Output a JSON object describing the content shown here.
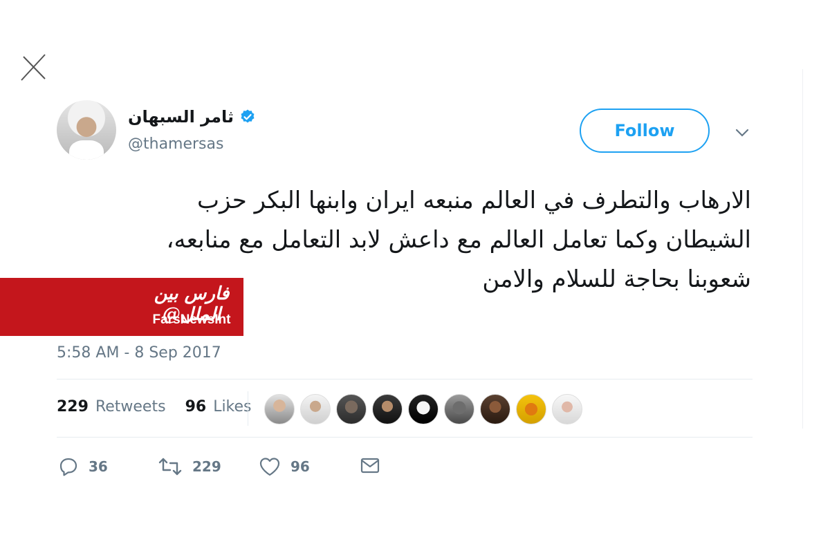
{
  "user": {
    "display_name": "ثامر السبهان",
    "handle": "@thamersas",
    "verified": true
  },
  "follow_button": {
    "label": "Follow"
  },
  "tweet": {
    "lines": [
      "الارهاب والتطرف في العالم منبعه ايران وابنها البكر حزب",
      "الشيطان وكما تعامل العالم مع داعش لابد التعامل مع منابعه،",
      "شعوبنا بحاجة للسلام والامن"
    ],
    "timestamp": "5:58 AM - 8 Sep 2017"
  },
  "watermark": {
    "persian": "فارس بین الملل@",
    "english": "FarsNewsInt"
  },
  "stats": {
    "retweets_count": "229",
    "retweets_label": "Retweets",
    "likes_count": "96",
    "likes_label": "Likes"
  },
  "actions": {
    "reply_count": "36",
    "retweet_count": "229",
    "like_count": "96"
  },
  "icons": {
    "close": "close-icon",
    "verified": "verified-badge-icon",
    "chevron": "chevron-down-icon",
    "reply": "reply-icon",
    "retweet": "retweet-icon",
    "like": "heart-icon",
    "message": "direct-message-icon"
  },
  "colors": {
    "accent": "#1da1f2",
    "muted": "#657786",
    "watermark_red": "#c4161c"
  }
}
